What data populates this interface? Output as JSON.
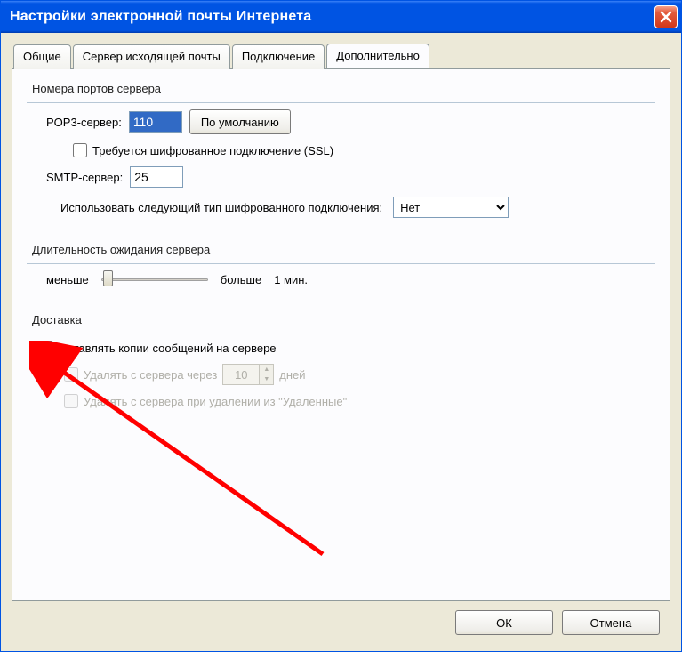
{
  "window": {
    "title": "Настройки электронной почты Интернета"
  },
  "tabs": [
    {
      "label": "Общие"
    },
    {
      "label": "Сервер исходящей почты"
    },
    {
      "label": "Подключение"
    },
    {
      "label": "Дополнительно"
    }
  ],
  "groups": {
    "ports": {
      "legend": "Номера портов сервера",
      "pop3_label": "POP3-сервер:",
      "pop3_value": "110",
      "default_btn": "По умолчанию",
      "ssl_label": "Требуется шифрованное подключение (SSL)",
      "smtp_label": "SMTP-сервер:",
      "smtp_value": "25",
      "enc_label": "Использовать следующий тип шифрованного подключения:",
      "enc_value": "Нет"
    },
    "timeout": {
      "legend": "Длительность ожидания сервера",
      "less": "меньше",
      "more": "больше",
      "value": "1 мин."
    },
    "delivery": {
      "legend": "Доставка",
      "leave_copy": "Оставлять копии сообщений на сервере",
      "delete_after": "Удалять с сервера через",
      "days_value": "10",
      "days_label": "дней",
      "delete_on_trash": "Удалять с сервера при удалении из \"Удаленные\""
    }
  },
  "footer": {
    "ok": "ОК",
    "cancel": "Отмена"
  }
}
